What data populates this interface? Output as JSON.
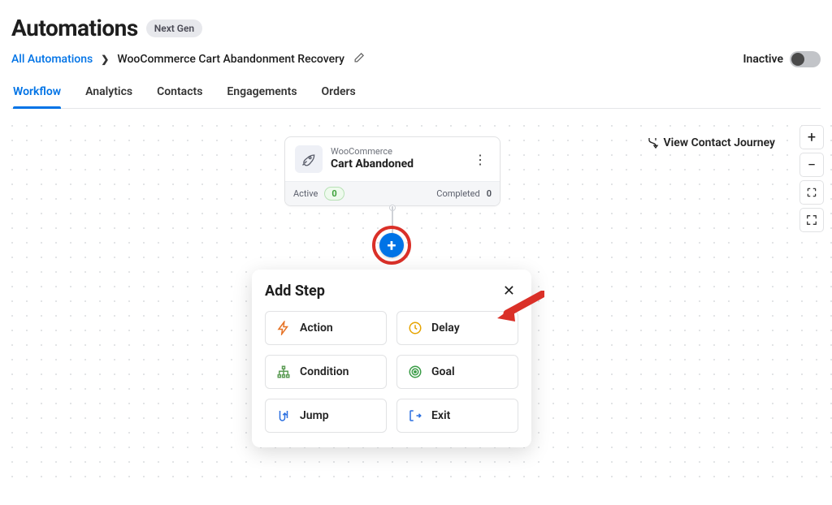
{
  "header": {
    "title": "Automations",
    "badge": "Next Gen"
  },
  "breadcrumb": {
    "root": "All Automations",
    "current": "WooCommerce Cart Abandonment Recovery"
  },
  "status": {
    "label": "Inactive"
  },
  "tabs": [
    "Workflow",
    "Analytics",
    "Contacts",
    "Engagements",
    "Orders"
  ],
  "active_tab": 0,
  "journey_link": "View Contact Journey",
  "node": {
    "pre": "WooCommerce",
    "title": "Cart Abandoned",
    "active_label": "Active",
    "active_count": "0",
    "completed_label": "Completed",
    "completed_count": "0"
  },
  "popup": {
    "title": "Add Step",
    "options": [
      {
        "label": "Action",
        "icon": "bolt",
        "color": "#e67326"
      },
      {
        "label": "Delay",
        "icon": "clock",
        "color": "#e6a400"
      },
      {
        "label": "Condition",
        "icon": "branch",
        "color": "#5c9c55"
      },
      {
        "label": "Goal",
        "icon": "target",
        "color": "#3a9c46"
      },
      {
        "label": "Jump",
        "icon": "jump",
        "color": "#2a6fe0"
      },
      {
        "label": "Exit",
        "icon": "exit",
        "color": "#2a6fe0"
      }
    ]
  }
}
